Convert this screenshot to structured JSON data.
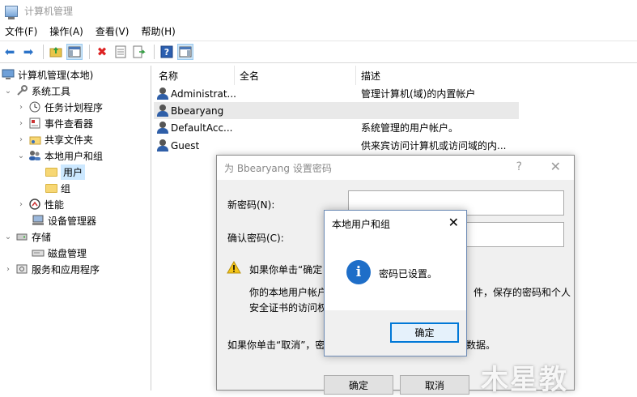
{
  "window": {
    "title": "计算机管理"
  },
  "menu": [
    "文件(F)",
    "操作(A)",
    "查看(V)",
    "帮助(H)"
  ],
  "tree": {
    "root": "计算机管理(本地)",
    "system_tools": "系统工具",
    "task_scheduler": "任务计划程序",
    "event_viewer": "事件查看器",
    "shared_folders": "共享文件夹",
    "local_users": "本地用户和组",
    "users": "用户",
    "groups": "组",
    "performance": "性能",
    "device_manager": "设备管理器",
    "storage": "存储",
    "disk_management": "磁盘管理",
    "services_apps": "服务和应用程序"
  },
  "list": {
    "columns": [
      "名称",
      "全名",
      "描述"
    ],
    "rows": [
      {
        "name": "Administrat...",
        "fullname": "",
        "desc": "管理计算机(域)的内置帐户"
      },
      {
        "name": "Bbearyang",
        "fullname": "",
        "desc": ""
      },
      {
        "name": "DefaultAcc...",
        "fullname": "",
        "desc": "系统管理的用户帐户。"
      },
      {
        "name": "Guest",
        "fullname": "",
        "desc": "供来宾访问计算机或访问域的内..."
      }
    ]
  },
  "password_dialog": {
    "title": "为 Bbearyang 设置密码",
    "help": "?",
    "close": "✕",
    "new_password_label": "新密码(N):",
    "confirm_password_label": "确认密码(C):",
    "warn_line1": "如果你单击“确定",
    "warn_right1": "件，保存的密码和个人",
    "warn_line2": "你的本地用户帐户",
    "warn_line3": "安全证书的访问权",
    "cancel_line_left": "如果你单击“取消”，密码",
    "cancel_line_right": "数据。",
    "ok": "确定",
    "cancel": "取消"
  },
  "message_box": {
    "title": "本地用户和组",
    "close": "✕",
    "icon": "i",
    "text": "密码已设置。",
    "ok": "确定"
  },
  "watermark": "木星教"
}
